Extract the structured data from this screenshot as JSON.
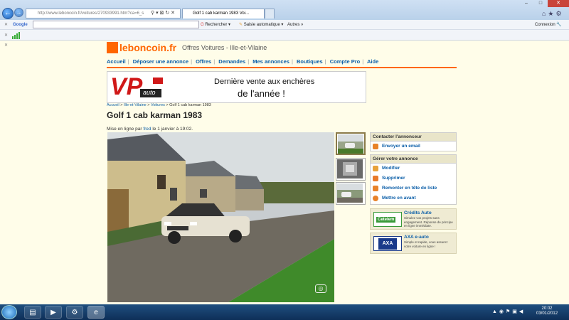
{
  "browser": {
    "url": "http://www.leboncoin.fr/voitures/270933991.htm?ca=6_s",
    "tabs": [
      {
        "label": "Golf 1 cab karman 1983 Voi..."
      }
    ],
    "window_controls": {
      "minimize": "–",
      "maximize": "□",
      "close": "✕"
    },
    "google_label": "Google",
    "rechercher_label": "Rechercher",
    "saisie_label": "Saisie automatique",
    "autres_label": "Autres",
    "connexion_label": "Connexion"
  },
  "site": {
    "logo_text": "leboncoin.fr",
    "title": "Offres Voitures - Ille-et-Vilaine",
    "nav": [
      "Accueil",
      "Déposer une annonce",
      "Offres",
      "Demandes",
      "Mes annonces",
      "Boutiques",
      "Compte Pro",
      "Aide"
    ]
  },
  "banner": {
    "brand": "VP",
    "brand_sub": "auto",
    "line1": "Dernière vente aux enchères",
    "line2": "de l'année !"
  },
  "breadcrumb": {
    "items": [
      "Accueil",
      "Ille-et-Vilaine",
      "Voitures"
    ],
    "current": "Golf 1 cab karman 1983"
  },
  "ad": {
    "title": "Golf 1 cab karman 1983",
    "posted_prefix": "Mise en ligne par",
    "author": "fred",
    "posted_suffix": "le 1 janvier à 19:02."
  },
  "panels": {
    "contact": {
      "header": "Contacter l'annonceur",
      "items": [
        {
          "label": "Envoyer un email",
          "icon": "envelope-icon",
          "color": "#e8822a"
        }
      ]
    },
    "manage": {
      "header": "Gérer votre annonce",
      "items": [
        {
          "label": "Modifier",
          "icon": "pencil-icon",
          "color": "#e8a23a"
        },
        {
          "label": "Supprimer",
          "icon": "trash-icon",
          "color": "#e87a2a"
        },
        {
          "label": "Remonter en tête de liste",
          "icon": "arrow-up-icon",
          "color": "#e8822a"
        },
        {
          "label": "Mettre en avant",
          "icon": "star-icon",
          "color": "#e8822a"
        }
      ]
    }
  },
  "promos": [
    {
      "title": "Crédits Auto",
      "logo": "Cetelem",
      "desc": "Simulez vos projets sans engagement. Réponse de principe en ligne immédiate."
    },
    {
      "title": "AXA e-auto",
      "logo": "AXA",
      "desc": "Simple et rapide, vous assurez votre voiture en ligne !"
    }
  ],
  "taskbar": {
    "time": "20:02",
    "date": "03/01/2012"
  }
}
